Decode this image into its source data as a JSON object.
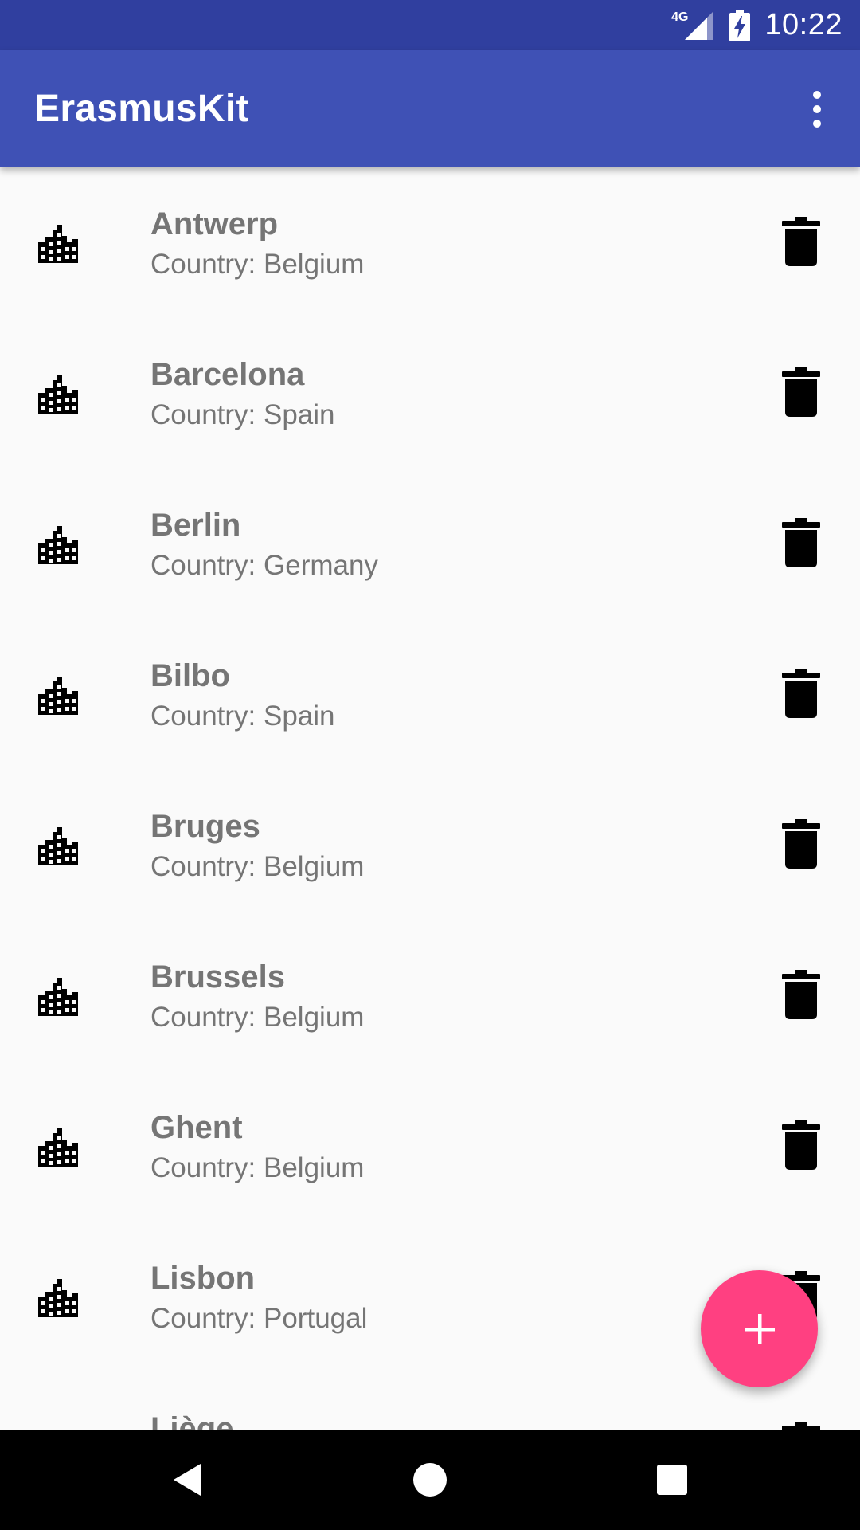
{
  "status_bar": {
    "network": "4G",
    "time": "10:22",
    "colors": {
      "background": "#303f9f"
    }
  },
  "app_bar": {
    "title": "ErasmusKit",
    "overflow_icon": "more-vert-icon",
    "colors": {
      "background": "#3f51b5"
    }
  },
  "cities": [
    {
      "name": "Antwerp",
      "country": "Country: Belgium"
    },
    {
      "name": "Barcelona",
      "country": "Country: Spain"
    },
    {
      "name": "Berlin",
      "country": "Country: Germany"
    },
    {
      "name": "Bilbo",
      "country": "Country: Spain"
    },
    {
      "name": "Bruges",
      "country": "Country: Belgium"
    },
    {
      "name": "Brussels",
      "country": "Country: Belgium"
    },
    {
      "name": "Ghent",
      "country": "Country: Belgium"
    },
    {
      "name": "Lisbon",
      "country": "Country: Portugal"
    },
    {
      "name": "Liège",
      "country": ""
    }
  ],
  "list_icons": {
    "item": "city-icon",
    "action": "delete-icon"
  },
  "fab": {
    "icon": "add-icon",
    "color": "#ff4081"
  },
  "nav_bar": {
    "back": "back-icon",
    "home": "home-icon",
    "recents": "recents-icon"
  }
}
